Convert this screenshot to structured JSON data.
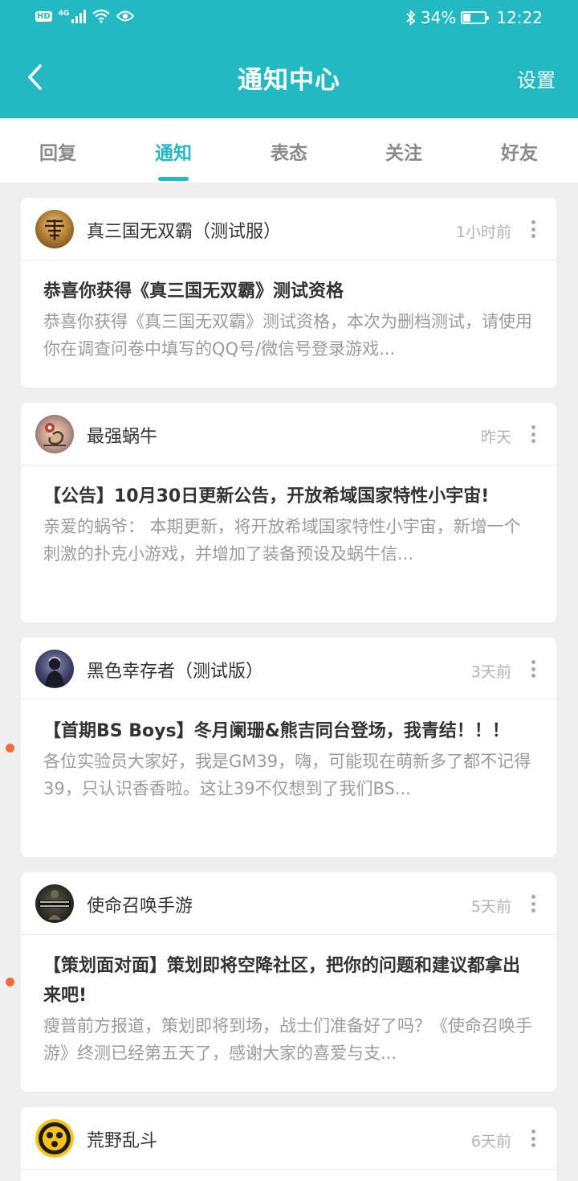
{
  "statusbar": {
    "network": "4G",
    "battery": "34%",
    "battery_level": 0.34,
    "time": "12:22"
  },
  "header": {
    "title": "通知中心",
    "settings_label": "设置"
  },
  "tabs": [
    {
      "label": "回复",
      "active": false
    },
    {
      "label": "通知",
      "active": true
    },
    {
      "label": "表态",
      "active": false
    },
    {
      "label": "关注",
      "active": false
    },
    {
      "label": "好友",
      "active": false
    }
  ],
  "notifications": [
    {
      "game": "真三国无双霸（测试服）",
      "time": "1小时前",
      "title": "恭喜你获得《真三国无双霸》测试资格",
      "excerpt": "恭喜你获得《真三国无双霸》测试资格，本次为删档测试，请使用你在调查问卷中填写的QQ号/微信号登录游戏...",
      "unread": false
    },
    {
      "game": "最强蜗牛",
      "time": "昨天",
      "title": "【公告】10月30日更新公告，开放希域国家特性小宇宙!",
      "excerpt": "亲爱的蜗爷： 本期更新，将开放希域国家特性小宇宙，新增一个刺激的扑克小游戏，并增加了装备预设及蜗牛信...",
      "unread": false
    },
    {
      "game": "黑色幸存者（测试版）",
      "time": "3天前",
      "title": "【首期BS Boys】冬月阑珊&熊吉同台登场，我青结！！！",
      "excerpt": "各位实验员大家好，我是GM39，嗨，可能现在萌新多了都不记得39，只认识香香啦。这让39不仅想到了我们BS...",
      "unread": true
    },
    {
      "game": "使命召唤手游",
      "time": "5天前",
      "title": "【策划面对面】策划即将空降社区，把你的问题和建议都拿出来吧!",
      "excerpt": "瘦普前方报道，策划即将到场，战士们准备好了吗？《使命召唤手游》终测已经第五天了，感谢大家的喜爱与支...",
      "unread": true
    },
    {
      "game": "荒野乱斗",
      "time": "6天前",
      "title": "",
      "excerpt": "",
      "unread": false
    }
  ],
  "colors": {
    "accent": "#23b9c3",
    "unread_dot": "#f46a3a",
    "background": "#efefef"
  }
}
